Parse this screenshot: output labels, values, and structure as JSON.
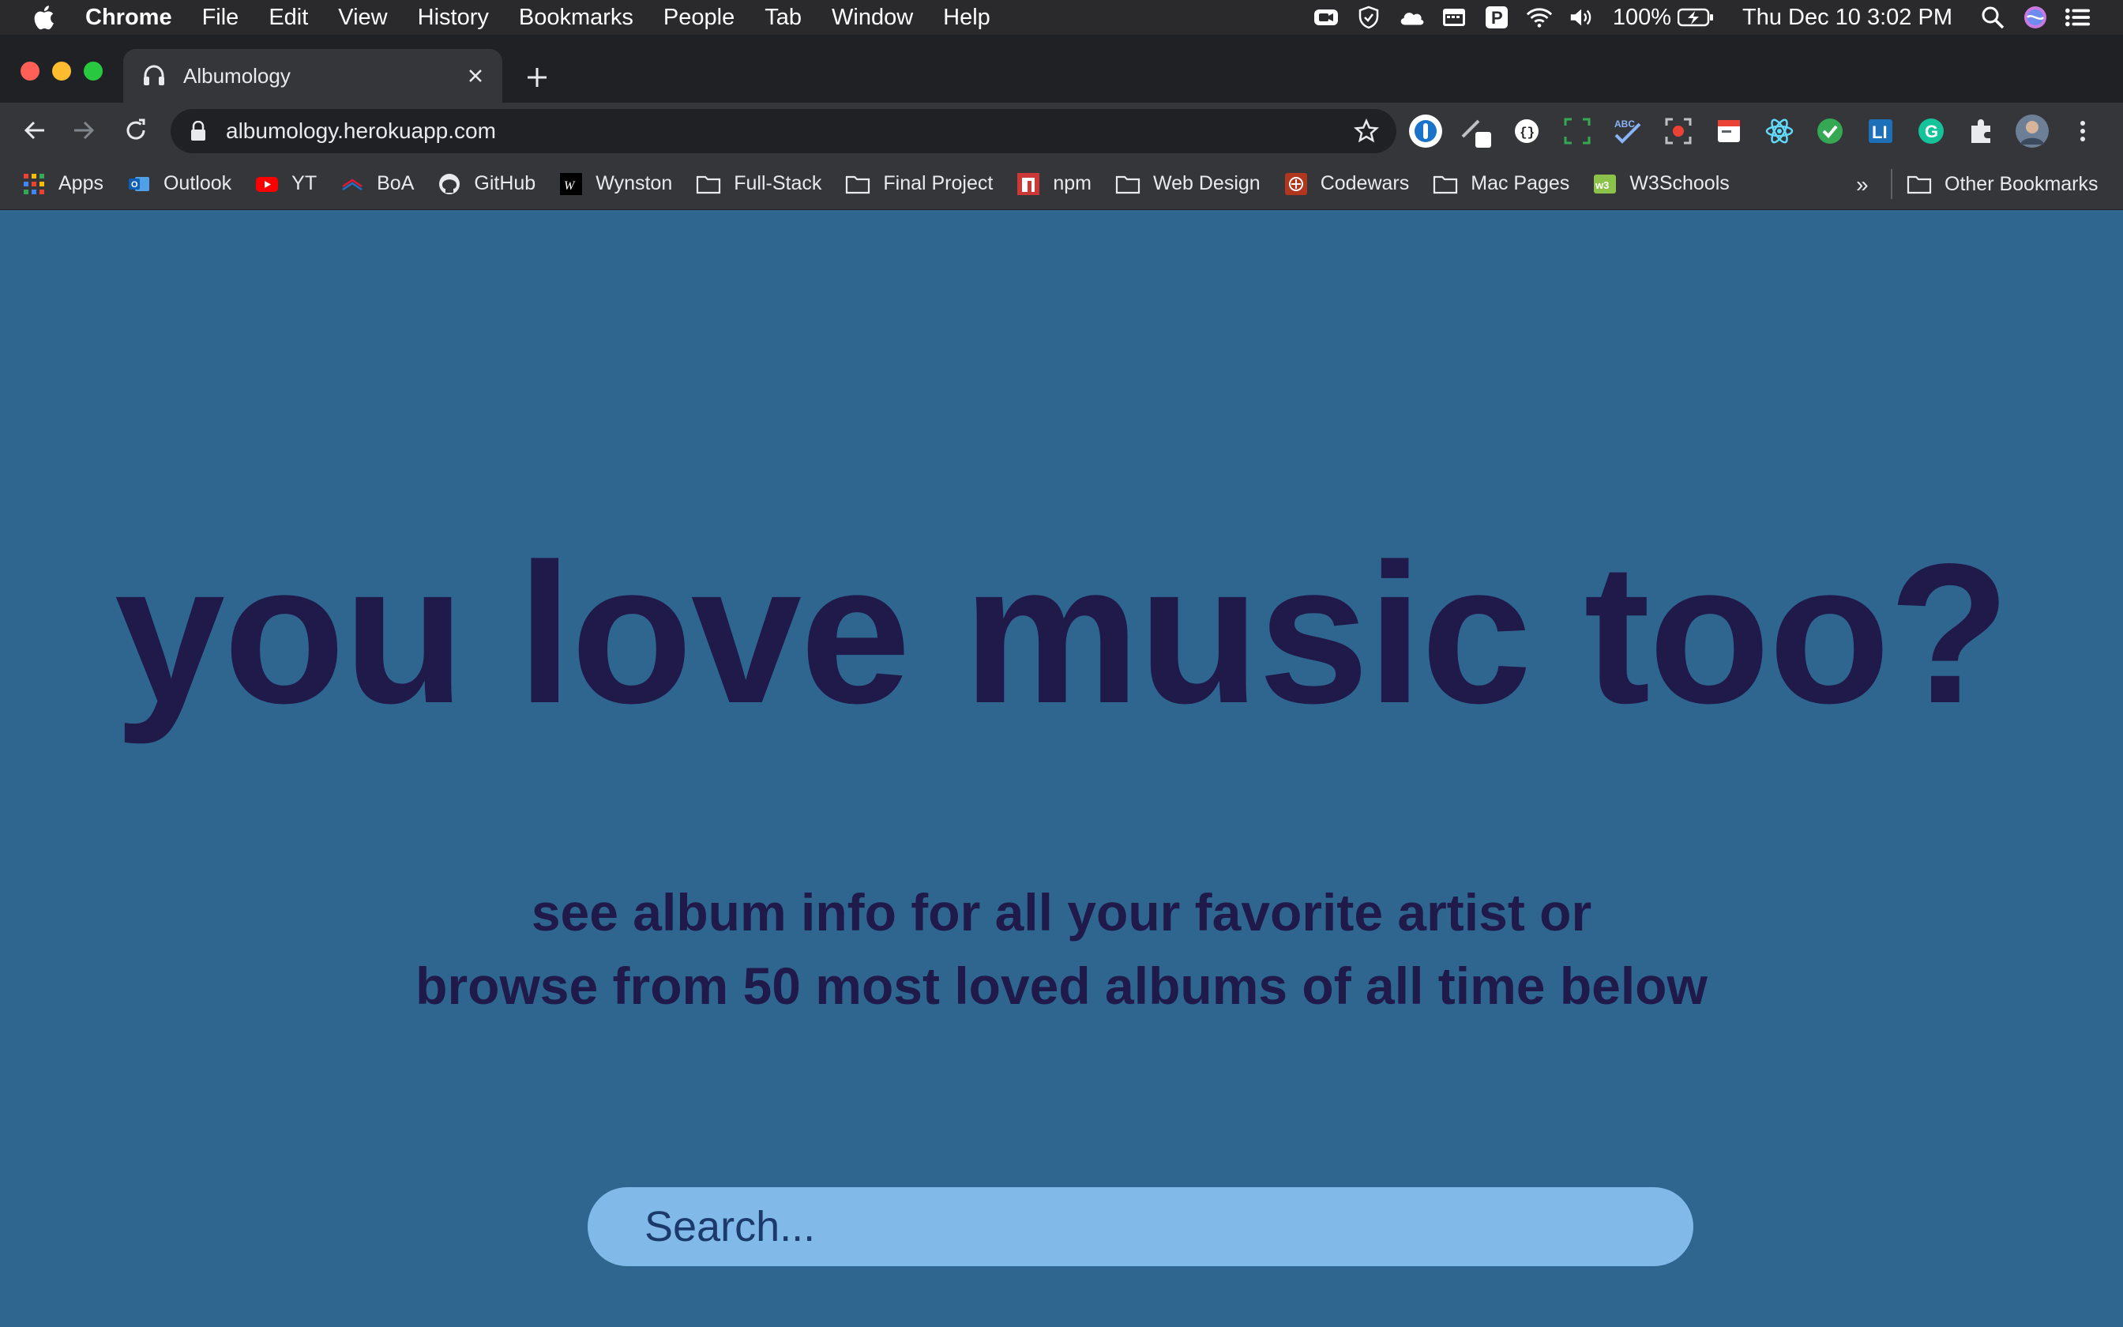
{
  "menubar": {
    "app_name": "Chrome",
    "items": [
      "File",
      "Edit",
      "View",
      "History",
      "Bookmarks",
      "People",
      "Tab",
      "Window",
      "Help"
    ],
    "battery": "100%",
    "datetime": "Thu Dec 10  3:02 PM"
  },
  "tab": {
    "title": "Albumology"
  },
  "omnibox": {
    "url": "albumology.herokuapp.com"
  },
  "bookmarks": {
    "items": [
      "Apps",
      "Outlook",
      "YT",
      "BoA",
      "GitHub",
      "Wynston",
      "Full-Stack",
      "Final Project",
      "npm",
      "Web Design",
      "Codewars",
      "Mac Pages",
      "W3Schools"
    ],
    "overflow": "»",
    "other": "Other Bookmarks"
  },
  "page": {
    "headline": "you love music too?",
    "subline_1": "see album info for all your favorite artist or",
    "subline_2": "browse from 50 most loved albums of all time below",
    "search_placeholder": "Search..."
  },
  "colors": {
    "page_background": "#2f6690",
    "headline_text": "#1f1a4a",
    "search_background": "#81b9e8"
  }
}
